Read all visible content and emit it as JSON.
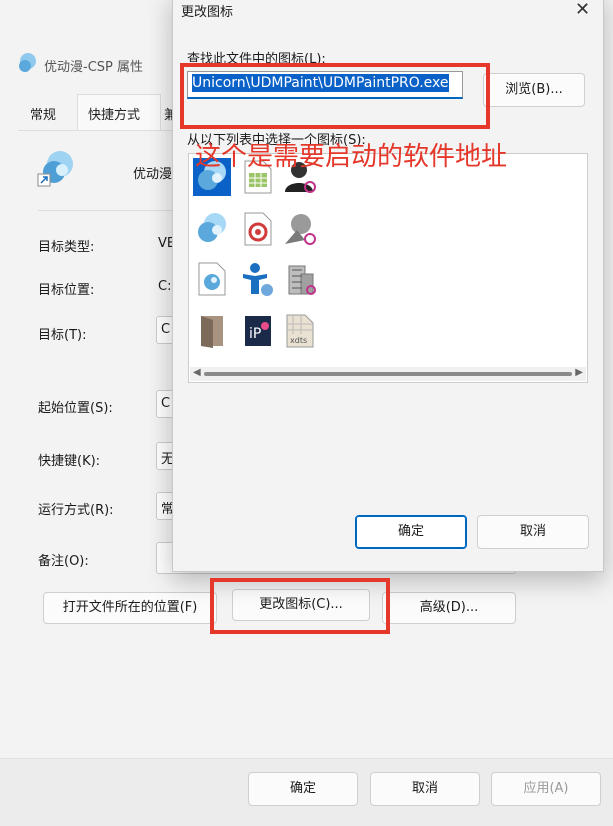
{
  "props_window": {
    "title": "优动漫-CSP 属性",
    "tabs": [
      "常规",
      "快捷方式",
      "兼"
    ],
    "app_name": "优动漫",
    "rows": [
      {
        "label": "目标类型:",
        "value": "VE"
      },
      {
        "label": "目标位置:",
        "value": "C:"
      },
      {
        "label": "目标(T):",
        "value": "C"
      },
      {
        "label": "起始位置(S):",
        "value": "C"
      },
      {
        "label": "快捷键(K):",
        "value": "无"
      },
      {
        "label": "运行方式(R):",
        "value": "常"
      },
      {
        "label": "备注(O):",
        "value": ""
      }
    ],
    "buttons": {
      "open_location": "打开文件所在的位置(F)",
      "change_icon": "更改图标(C)...",
      "advanced": "高级(D)...",
      "ok": "确定",
      "cancel": "取消",
      "apply": "应用(A)"
    }
  },
  "change_icon_dialog": {
    "title": "更改图标",
    "close": "✕",
    "find_label": "查找此文件中的图标(L):",
    "file_path": "Unicorn\\UDMPaint\\UDMPaintPRO.exe",
    "browse": "浏览(B)...",
    "list_label": "从以下列表中选择一个图标(S):",
    "icons": [
      "udm-paint-icon",
      "document-grid-icon",
      "user-dark-icon",
      "udm-paint-icon",
      "document-red-icon",
      "user-gray-icon",
      "udm-document-icon",
      "user-network-icon",
      "building-icon",
      "door-icon",
      "ip-app-icon",
      "xdts-file-icon"
    ],
    "xdts_label": "xdts",
    "ok": "确定",
    "cancel": "取消"
  },
  "annotation": {
    "note": "这个是需要启动的软件地址",
    "color": "#e5372a"
  }
}
